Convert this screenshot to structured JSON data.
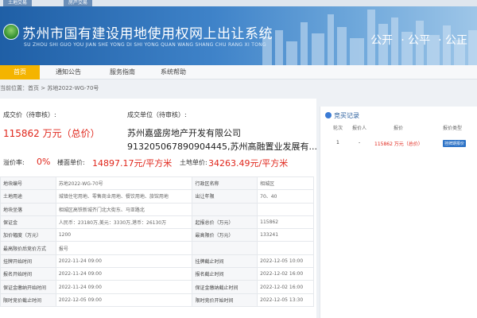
{
  "topbar": {
    "tabs": [
      "土地交易",
      "房产交易"
    ]
  },
  "header": {
    "title": "苏州市国有建设用地使用权网上出让系统",
    "subtitle": "SU ZHOU SHI GUO YOU JIAN SHE YONG DI SHI YONG QUAN WANG SHANG CHU RANG XI TONG",
    "slogans": [
      "公开",
      "· 公平",
      "· 公正"
    ]
  },
  "nav": {
    "items": [
      "首页",
      "通知公告",
      "服务指南",
      "系统帮助"
    ]
  },
  "breadcrumb": "当前位置：首页 > 苏地2022-WG-70号",
  "deal": {
    "price_label": "成交价（待审核）:",
    "price_value": "115862 万元（总价）",
    "party_label": "成交单位（待审核）:",
    "party_name": "苏州嘉盛房地产开发有限公司",
    "party_detail": "913205067890904445,苏州高融置业发展有..."
  },
  "metrics": {
    "premium_label": "溢价率:",
    "premium_value": "0%",
    "floor_label": "楼面单价:",
    "floor_value": "14897.17元/平方米",
    "land_label": "土地单价:",
    "land_value": "34263.49元/平方米"
  },
  "info_rows": [
    {
      "k1": "地块编号",
      "v1": "苏地2022-WG-70号",
      "k2": "行政区名称",
      "v2": "相城区"
    },
    {
      "k1": "土地用途",
      "v1": "城镇住宅用地、零售商业用地、餐饮用地、旅馆用地",
      "k2": "出让年限",
      "v2": "70、40"
    },
    {
      "k1": "地块坐落",
      "v1": "相城区高铁新城齐门北大街东、马亚路北",
      "k2": "",
      "v2": ""
    },
    {
      "k1": "保证金",
      "v1": "人民币：23180万,美元：3330万,港币：26130万",
      "k2": "起报总价（万元）",
      "v2": "115862"
    },
    {
      "k1": "加价幅度（万元）",
      "v1": "1200",
      "k2": "最高限价（万元）",
      "v2": "133241"
    },
    {
      "k1": "最高限价后竞价方式",
      "v1": "报号",
      "k2": "",
      "v2": ""
    },
    {
      "k1": "挂牌开始时间",
      "v1": "2022-11-24 09:00",
      "k2": "挂牌截止时间",
      "v2": "2022-12-05 10:00"
    },
    {
      "k1": "报名开始时间",
      "v1": "2022-11-24 09:00",
      "k2": "报名截止时间",
      "v2": "2022-12-02 16:00"
    },
    {
      "k1": "保证金缴纳开始时间",
      "v1": "2022-11-24 09:00",
      "k2": "保证金缴纳截止时间",
      "v2": "2022-12-02 16:00"
    },
    {
      "k1": "限时竞价截止时间",
      "v1": "2022-12-05 09:00",
      "k2": "限时竞价开始时间",
      "v2": "2022-12-05 13:30"
    }
  ],
  "sidebar": {
    "title": "竞买记录",
    "headers": [
      "轮次",
      "报价人",
      "报价",
      "报价类型"
    ],
    "row": {
      "round": "1",
      "bidder": "-",
      "price": "115862 万元（总价）",
      "type": "挂牌期报价"
    }
  },
  "colors": {
    "accent": "#f4b400",
    "price_red": "#e0261b",
    "header_blue": "#1f5fa6"
  }
}
